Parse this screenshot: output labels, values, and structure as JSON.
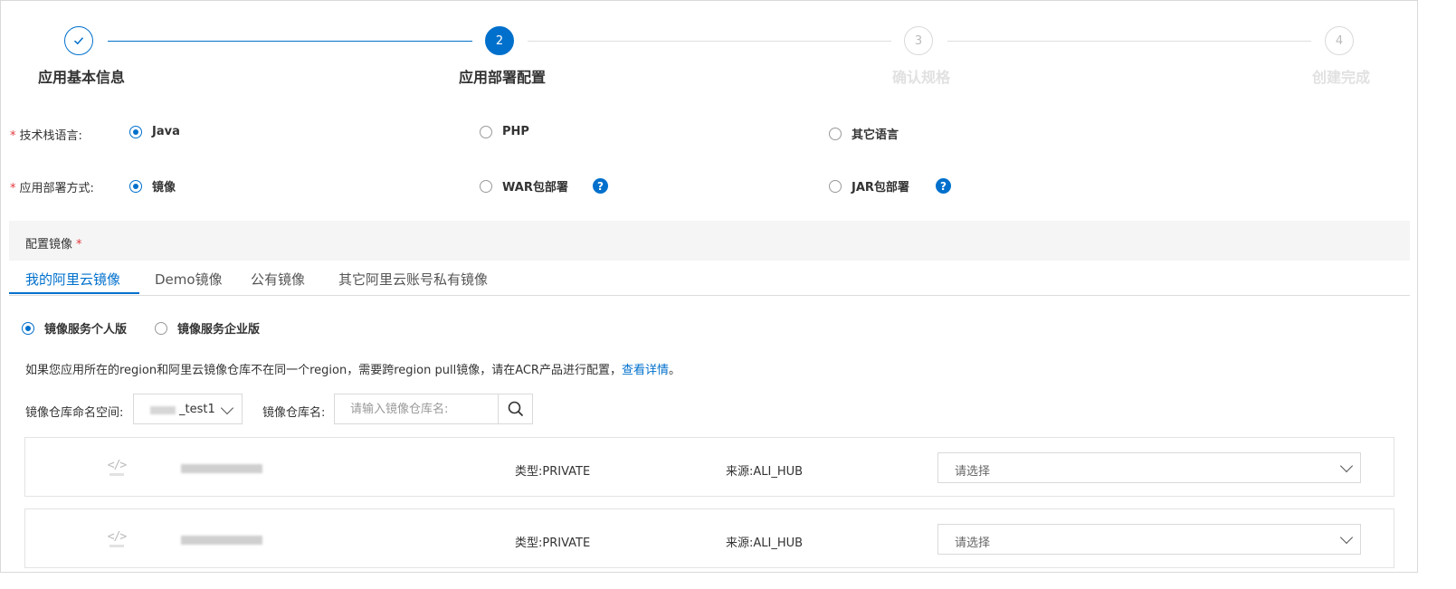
{
  "stepper": {
    "steps": [
      {
        "number": "",
        "title": "应用基本信息",
        "state": "done"
      },
      {
        "number": "2",
        "title": "应用部署配置",
        "state": "active"
      },
      {
        "number": "3",
        "title": "确认规格",
        "state": "todo"
      },
      {
        "number": "4",
        "title": "创建完成",
        "state": "todo"
      }
    ]
  },
  "language": {
    "required_mark": "*",
    "label": "技术栈语言:",
    "options": [
      "Java",
      "PHP",
      "其它语言"
    ],
    "selected": "Java"
  },
  "deploy": {
    "required_mark": "*",
    "label": "应用部署方式:",
    "options": [
      "镜像",
      "WAR包部署",
      "JAR包部署"
    ],
    "selected": "镜像",
    "help_glyph": "?"
  },
  "config_image": {
    "title": "配置镜像",
    "required_mark": "*"
  },
  "tabs": {
    "items": [
      "我的阿里云镜像",
      "Demo镜像",
      "公有镜像",
      "其它阿里云账号私有镜像"
    ],
    "active": "我的阿里云镜像"
  },
  "edition": {
    "options": [
      "镜像服务个人版",
      "镜像服务企业版"
    ],
    "selected": "镜像服务个人版"
  },
  "notice": {
    "text": "如果您应用所在的region和阿里云镜像仓库不在同一个region，需要跨region pull镜像，请在ACR产品进行配置，",
    "link": "查看详情",
    "tail": "。"
  },
  "filters": {
    "namespace_label": "镜像仓库命名空间:",
    "namespace_value": "_test1",
    "repo_label": "镜像仓库名:",
    "repo_placeholder": "请输入镜像仓库名:"
  },
  "images": [
    {
      "icon": "code-icon",
      "type": "类型:PRIVATE",
      "source": "来源:ALI_HUB",
      "version_placeholder": "请选择"
    },
    {
      "icon": "code-icon",
      "type": "类型:PRIVATE",
      "source": "来源:ALI_HUB",
      "version_placeholder": "请选择"
    }
  ],
  "colors": {
    "accent": "#0070cc",
    "required": "#e4393c",
    "panel_bg": "#f5f5f5"
  }
}
